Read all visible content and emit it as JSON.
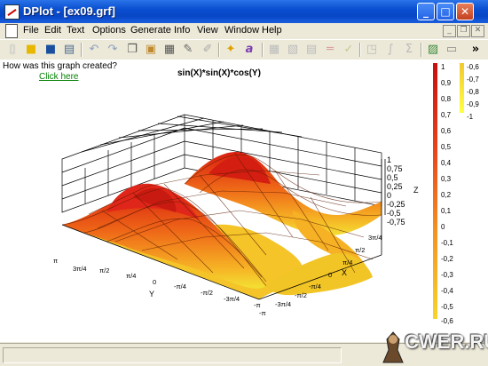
{
  "window": {
    "title": "DPlot - [ex09.grf]"
  },
  "menu": [
    "File",
    "Edit",
    "Text",
    "Options",
    "Generate",
    "Info",
    "View",
    "Window",
    "Help"
  ],
  "toolbar_icons": [
    "new-file-icon",
    "open-folder-icon",
    "save-icon",
    "print-icon",
    "undo-icon",
    "redo-icon",
    "copy-icon",
    "paste-icon",
    "edit-data-icon",
    "edit-icon",
    "bold-icon",
    "text-icon",
    "grid-icon",
    "zoom-icon",
    "tile-icon",
    "dash-icon",
    "check-icon",
    "shape-icon",
    "integral-icon",
    "sum-icon",
    "chart-color-icon",
    "copy-window-icon",
    "more-icon"
  ],
  "overflow_glyph": "»",
  "help": {
    "question": "How was this graph created?",
    "link": "Click here"
  },
  "plot": {
    "title": "sin(X)*sin(X)*cos(Y)",
    "z_ticks": [
      "1",
      "0,75",
      "0,5",
      "0,25",
      "0",
      "-0,25",
      "-0,5",
      "-0,75"
    ],
    "z_label": "Z",
    "x_label": "X",
    "y_label": "Y",
    "x_ticks": [
      "3π/4",
      "π/2",
      "π/4",
      "0",
      "-π/4",
      "-π/2",
      "-3π/4",
      "-π"
    ],
    "y_ticks": [
      "π",
      "3π/4",
      "π/2",
      "π/4",
      "0",
      "-π/4",
      "-π/2",
      "-3π/4",
      "-π"
    ]
  },
  "colorbar_left": [
    "1",
    "0,9",
    "0,8",
    "0,7",
    "0,6",
    "0,5",
    "0,4",
    "0,3",
    "0,2",
    "0,1",
    "0",
    "-0,1",
    "-0,2",
    "-0,3",
    "-0,4",
    "-0,5",
    "-0,6"
  ],
  "colorbar_right": [
    "-0,6",
    "-0,7",
    "-0,8",
    "-0,9",
    "-1"
  ],
  "watermark": "CWER.RU",
  "colors": {
    "titlebar": "#0a4fd0",
    "surface_high": "#dd2a10",
    "surface_low": "#f7e020",
    "link": "#008000"
  }
}
